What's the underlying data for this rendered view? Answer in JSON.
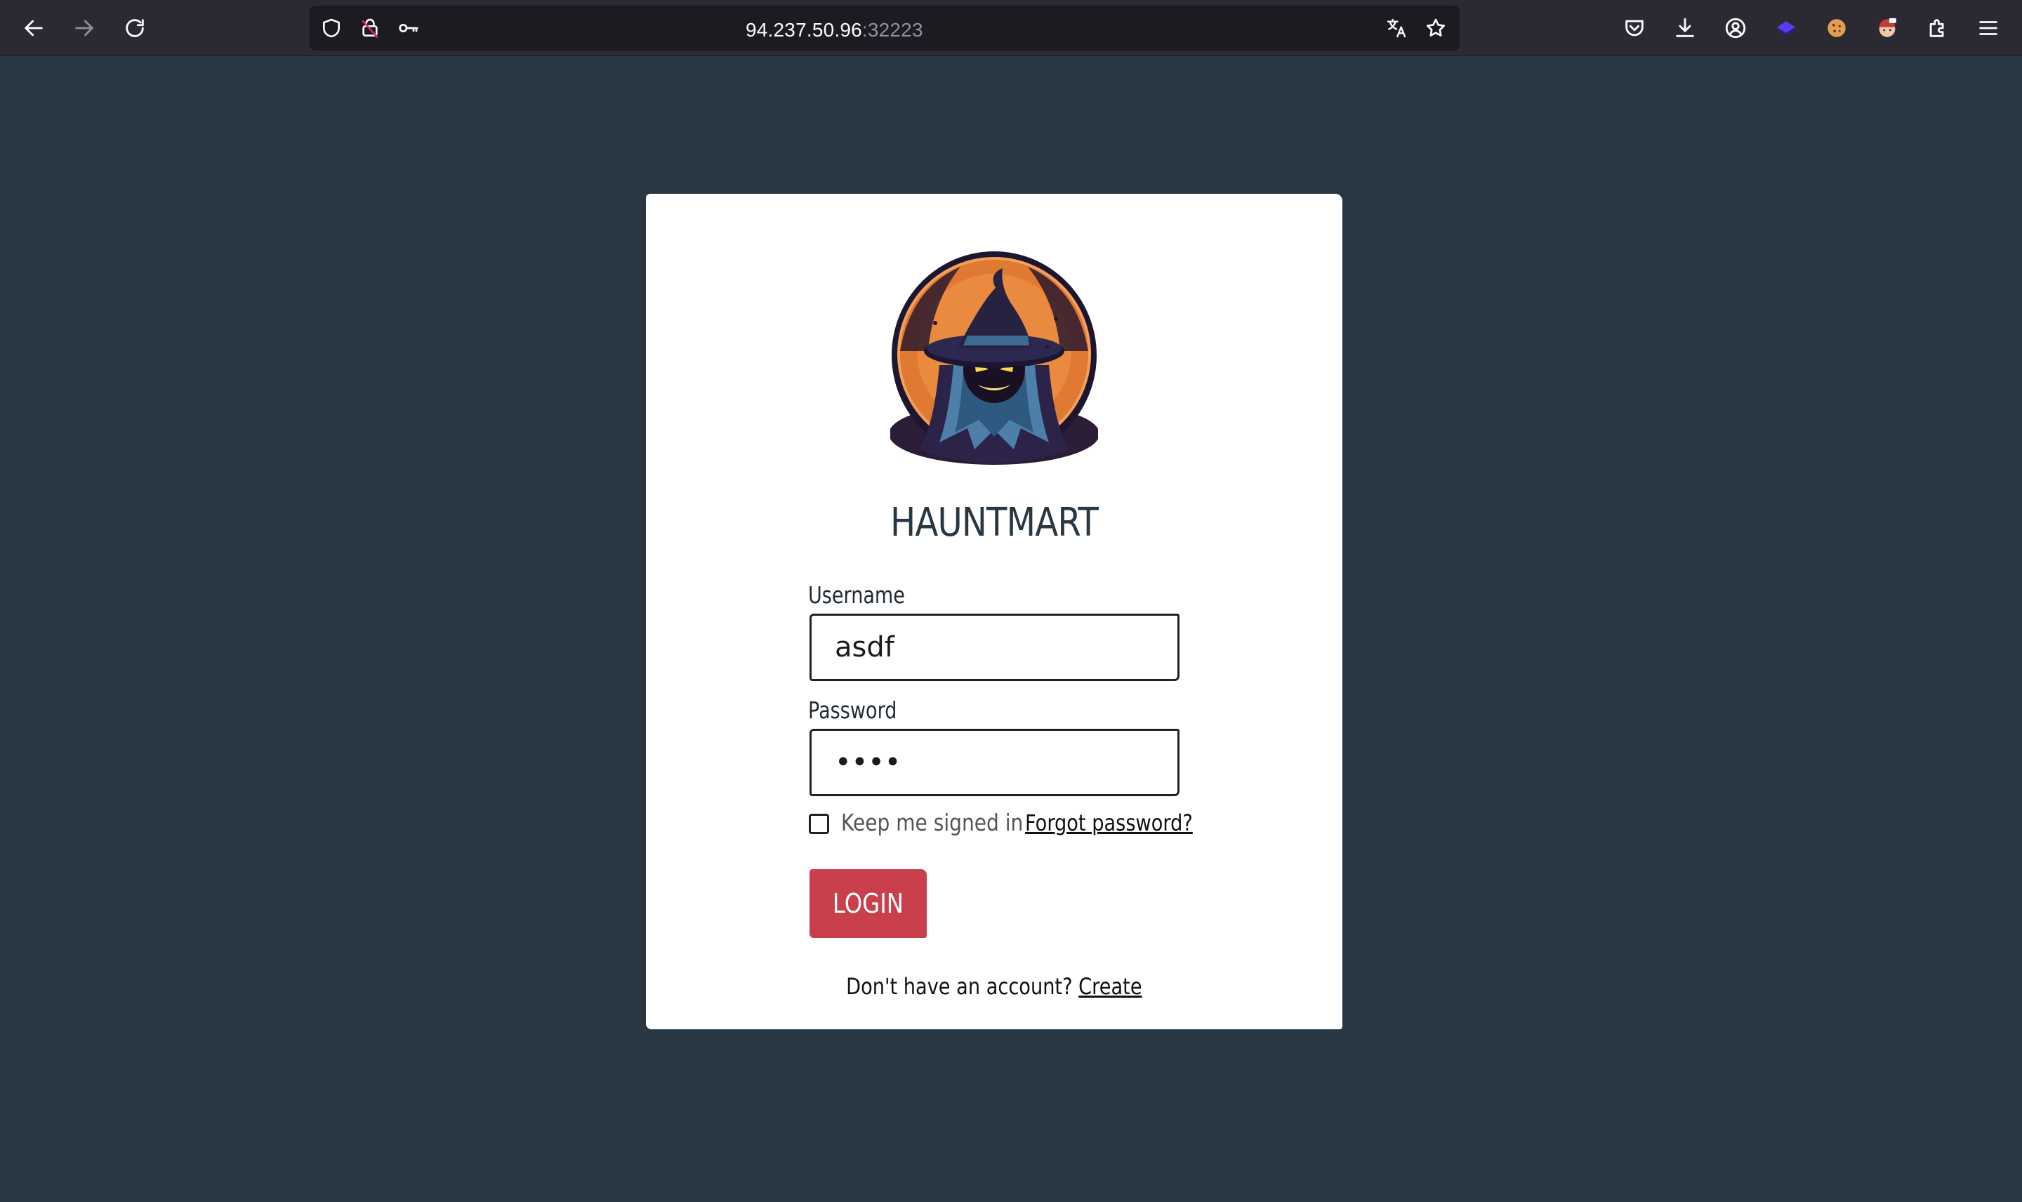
{
  "browser": {
    "url_host": "94.237.50.96",
    "url_port": ":32223",
    "toolbar_icons": [
      "back-arrow-icon",
      "forward-arrow-icon",
      "reload-icon",
      "shield-icon",
      "lock-icon",
      "key-icon",
      "translate-icon",
      "bookmark-star-icon",
      "pocket-icon",
      "download-icon",
      "account-icon",
      "extension-icon",
      "cookie-icon",
      "avatar-extension-icon",
      "puzzle-icon",
      "menu-icon"
    ],
    "colors": {
      "chrome": "#2b2a33",
      "urlbar": "#1c1b22"
    }
  },
  "login": {
    "brand": "HAUNTMART",
    "username_label": "Username",
    "username_value": "asdf",
    "password_label": "Password",
    "password_value": "asdf",
    "keep_signed_in_label": "Keep me signed in",
    "keep_signed_in_checked": false,
    "forgot_password": "Forgot password?",
    "login_button": "LOGIN",
    "no_account_text": "Don't have an account?",
    "create_link": "Create",
    "logo_icon": "witch-logo-icon"
  },
  "colors": {
    "page_background": "#283742",
    "card": "#ffffff",
    "login_button": "#c9404c",
    "brand_text": "#283742",
    "logo_orange": "#e07a32"
  }
}
